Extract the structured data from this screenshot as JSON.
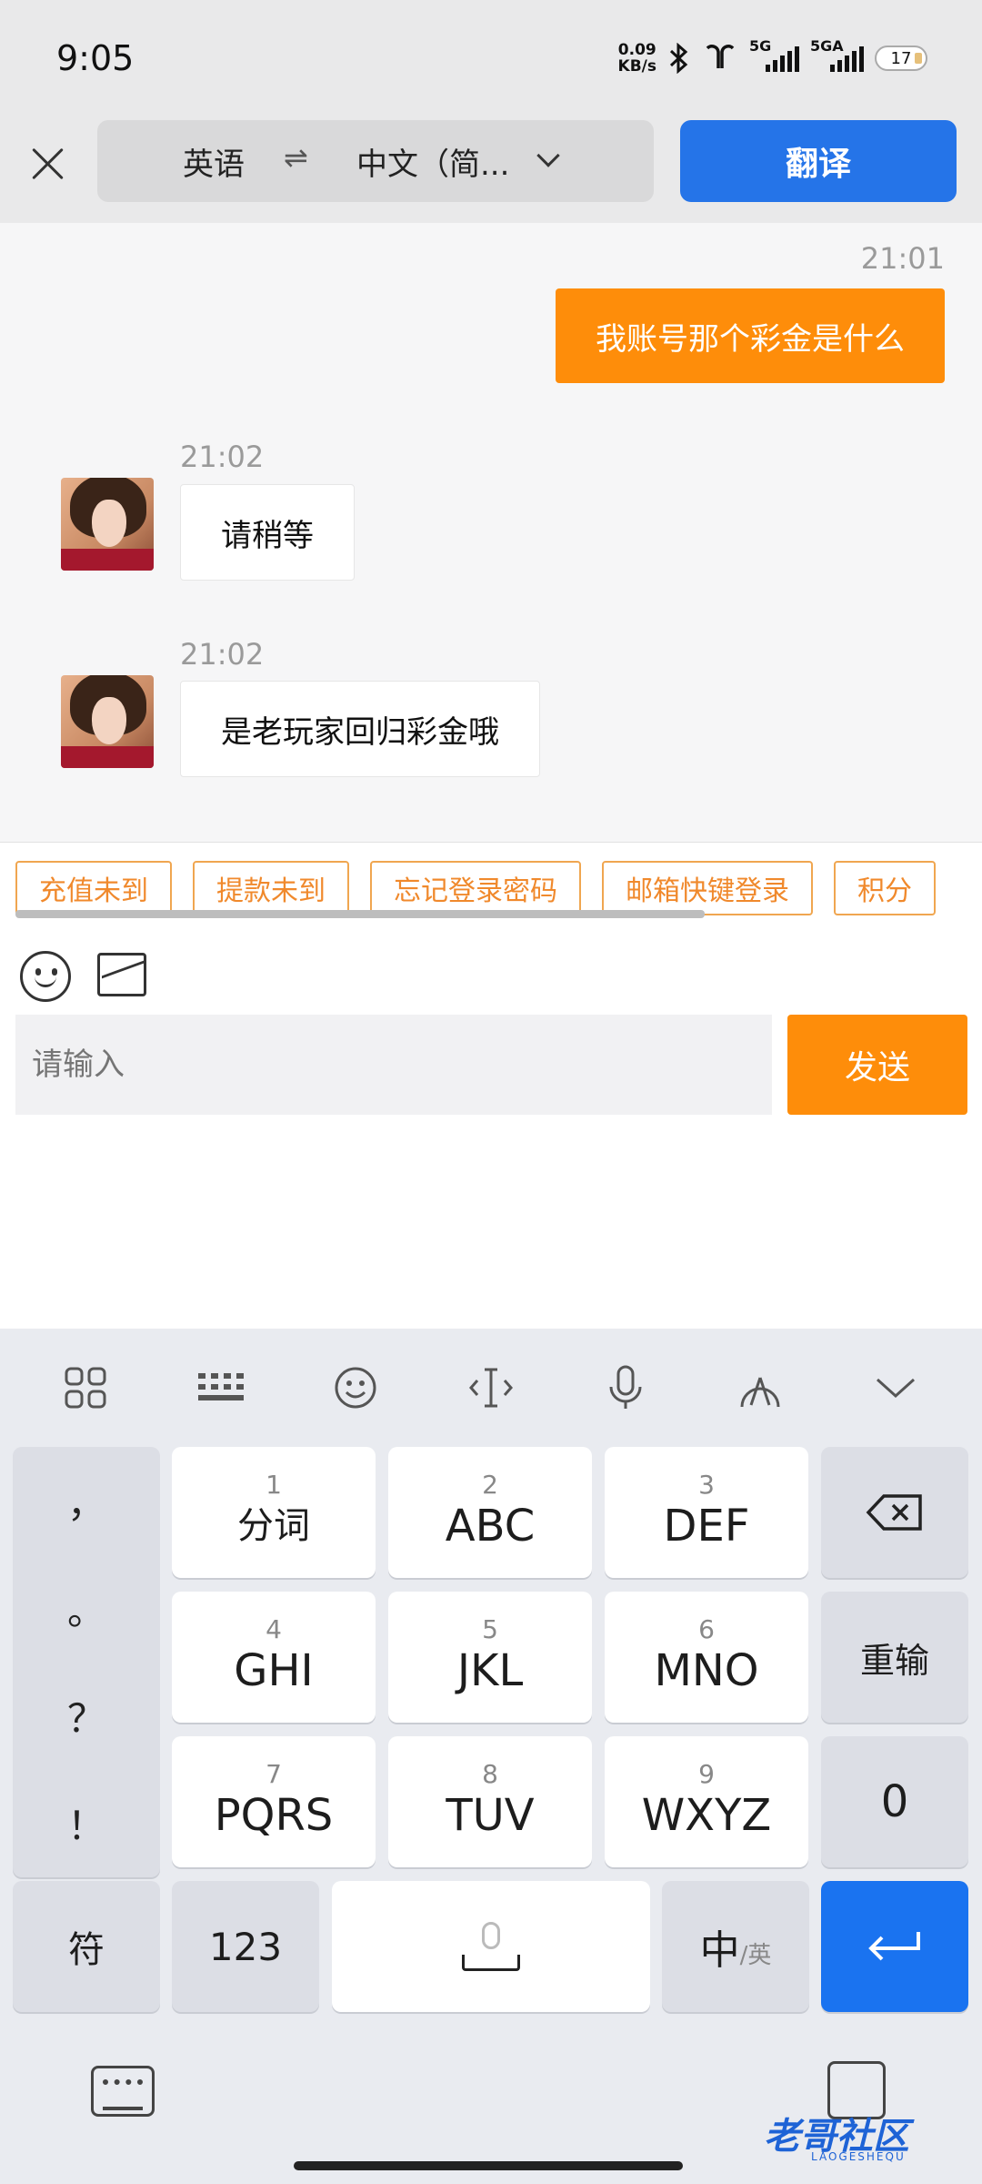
{
  "status_bar": {
    "time": "9:05",
    "net_speed_value": "0.09",
    "net_speed_unit": "KB/s",
    "signal1_label": "5G",
    "signal2_label": "5GA",
    "battery": "17"
  },
  "toolbar": {
    "source_lang": "英语",
    "swap_symbol": "⇌",
    "target_lang": "中文（简...",
    "translate_label": "翻译"
  },
  "chat": {
    "messages": [
      {
        "time": "21:01",
        "text": "我账号那个彩金是什么",
        "direction": "out"
      },
      {
        "time": "21:02",
        "text": "请稍等",
        "direction": "in"
      },
      {
        "time": "21:02",
        "text": "是老玩家回归彩金哦",
        "direction": "in"
      }
    ]
  },
  "quick_replies": [
    "充值未到",
    "提款未到",
    "忘记登录密码",
    "邮箱快键登录",
    "积分"
  ],
  "composer": {
    "placeholder": "请输入",
    "send_label": "发送"
  },
  "keyboard": {
    "punctuation": [
      "，",
      "。",
      "？",
      "！"
    ],
    "keys": [
      {
        "num": "1",
        "label": "分词"
      },
      {
        "num": "2",
        "label": "ABC"
      },
      {
        "num": "3",
        "label": "DEF"
      },
      {
        "num": "4",
        "label": "GHI"
      },
      {
        "num": "5",
        "label": "JKL"
      },
      {
        "num": "6",
        "label": "MNO"
      },
      {
        "num": "7",
        "label": "PQRS"
      },
      {
        "num": "8",
        "label": "TUV"
      },
      {
        "num": "9",
        "label": "WXYZ"
      }
    ],
    "reenter_label": "重输",
    "zero_label": "0",
    "symbols_label": "符",
    "numbers_label": "123",
    "lang_main": "中",
    "lang_sub": "/英"
  },
  "watermark": {
    "text": "老哥社区",
    "sub": "LAOGESHEQU"
  },
  "colors": {
    "accent_orange": "#fe8d0a",
    "accent_blue": "#2574e8",
    "enter_blue": "#1a73f0"
  }
}
